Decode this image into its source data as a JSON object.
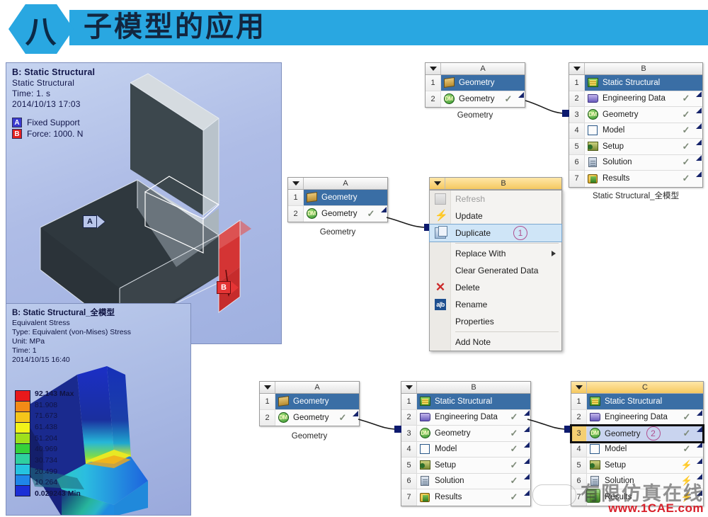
{
  "title": {
    "badge": "八",
    "heading": "子模型的应用"
  },
  "viewport_top": {
    "line1": "B: Static Structural",
    "line2": "Static Structural",
    "line3": "Time: 1. s",
    "line4": "2014/10/13 17:03",
    "tag_a_chip": "A",
    "tag_a_label": "Fixed Support",
    "tag_b_chip": "B",
    "tag_b_label": "Force: 1000. N",
    "marker_a": "A",
    "marker_b": "B"
  },
  "viewport_bottom": {
    "line1": "B: Static Structural_全模型",
    "line2": "Equivalent Stress",
    "line3": "Type: Equivalent (von-Mises) Stress",
    "line4": "Unit: MPa",
    "line5": "Time: 1",
    "line6": "2014/10/15 16:40",
    "legend_values": [
      "92.143 Max",
      "81.908",
      "71.673",
      "61.438",
      "51.204",
      "40.969",
      "30.734",
      "20.499",
      "10.264",
      "0.029243 Min"
    ],
    "legend_colors": [
      "#e8191b",
      "#f28a16",
      "#f5c51a",
      "#f2f319",
      "#9fe01c",
      "#36d13a",
      "#2fd0a0",
      "#25c3e0",
      "#1f86e8",
      "#1c2fd6"
    ]
  },
  "systems": {
    "geom_top": {
      "column": "A",
      "caption": "Geometry",
      "rows": [
        {
          "n": "1",
          "icon": "geometry-box-icon",
          "label": "Geometry",
          "state": "",
          "selected": true
        },
        {
          "n": "2",
          "icon": "design-modeler-icon",
          "label": "Geometry",
          "state": "✓",
          "selected": false
        }
      ]
    },
    "static_top": {
      "column": "B",
      "caption": "Static Structural_全模型",
      "rows": [
        {
          "n": "1",
          "icon": "static-structural-icon",
          "label": "Static Structural",
          "state": "",
          "selected": true
        },
        {
          "n": "2",
          "icon": "engineering-data-icon",
          "label": "Engineering Data",
          "state": "✓",
          "selected": false
        },
        {
          "n": "3",
          "icon": "design-modeler-icon",
          "label": "Geometry",
          "state": "✓",
          "selected": false
        },
        {
          "n": "4",
          "icon": "model-icon",
          "label": "Model",
          "state": "✓",
          "selected": false
        },
        {
          "n": "5",
          "icon": "setup-icon",
          "label": "Setup",
          "state": "✓",
          "selected": false
        },
        {
          "n": "6",
          "icon": "solution-icon",
          "label": "Solution",
          "state": "✓",
          "selected": false
        },
        {
          "n": "7",
          "icon": "results-icon",
          "label": "Results",
          "state": "✓",
          "selected": false
        }
      ]
    },
    "geom_mid": {
      "column": "A",
      "caption": "Geometry",
      "rows": [
        {
          "n": "1",
          "icon": "geometry-box-icon",
          "label": "Geometry",
          "state": "",
          "selected": true
        },
        {
          "n": "2",
          "icon": "design-modeler-icon",
          "label": "Geometry",
          "state": "✓",
          "selected": false
        }
      ]
    },
    "static_mid": {
      "column": "B"
    },
    "geom_bottom": {
      "column": "A",
      "caption": "Geometry",
      "rows": [
        {
          "n": "1",
          "icon": "geometry-box-icon",
          "label": "Geometry",
          "state": "",
          "selected": true
        },
        {
          "n": "2",
          "icon": "design-modeler-icon",
          "label": "Geometry",
          "state": "✓",
          "selected": false
        }
      ]
    },
    "static_bottom": {
      "column": "B",
      "rows": [
        {
          "n": "1",
          "icon": "static-structural-icon",
          "label": "Static Structural",
          "state": "",
          "selected": true
        },
        {
          "n": "2",
          "icon": "engineering-data-icon",
          "label": "Engineering Data",
          "state": "✓",
          "selected": false
        },
        {
          "n": "3",
          "icon": "design-modeler-icon",
          "label": "Geometry",
          "state": "✓",
          "selected": false
        },
        {
          "n": "4",
          "icon": "model-icon",
          "label": "Model",
          "state": "✓",
          "selected": false
        },
        {
          "n": "5",
          "icon": "setup-icon",
          "label": "Setup",
          "state": "✓",
          "selected": false
        },
        {
          "n": "6",
          "icon": "solution-icon",
          "label": "Solution",
          "state": "✓",
          "selected": false
        },
        {
          "n": "7",
          "icon": "results-icon",
          "label": "Results",
          "state": "✓",
          "selected": false
        }
      ]
    },
    "copy_c": {
      "column": "C",
      "step_badge": "2",
      "rows": [
        {
          "n": "1",
          "icon": "static-structural-icon",
          "label": "Static Structural",
          "state": "",
          "selected": true
        },
        {
          "n": "2",
          "icon": "engineering-data-icon",
          "label": "Engineering Data",
          "state": "✓",
          "selected": false
        },
        {
          "n": "3",
          "icon": "design-modeler-icon",
          "label": "Geometry",
          "state": "✓",
          "selected": false
        },
        {
          "n": "4",
          "icon": "model-icon",
          "label": "Model",
          "state": "✓",
          "selected": false
        },
        {
          "n": "5",
          "icon": "setup-icon",
          "label": "Setup",
          "state": "⚡",
          "selected": false
        },
        {
          "n": "6",
          "icon": "solution-icon",
          "label": "Solution",
          "state": "⚡",
          "selected": false
        },
        {
          "n": "7",
          "icon": "results-icon",
          "label": "Results",
          "state": "⚡",
          "selected": false
        }
      ]
    }
  },
  "context_menu": {
    "step_badge": "1",
    "items": [
      {
        "label": "Refresh",
        "icon": "refresh-icon",
        "disabled": true,
        "highlighted": false,
        "submenu": false
      },
      {
        "label": "Update",
        "icon": "update-icon",
        "disabled": false,
        "highlighted": false,
        "submenu": false
      },
      {
        "label": "Duplicate",
        "icon": "duplicate-icon",
        "disabled": false,
        "highlighted": true,
        "submenu": false
      },
      {
        "label": "Replace With",
        "icon": "",
        "disabled": false,
        "highlighted": false,
        "submenu": true
      },
      {
        "label": "Clear Generated Data",
        "icon": "",
        "disabled": false,
        "highlighted": false,
        "submenu": false
      },
      {
        "label": "Delete",
        "icon": "delete-icon",
        "disabled": false,
        "highlighted": false,
        "submenu": false
      },
      {
        "label": "Rename",
        "icon": "rename-icon",
        "disabled": false,
        "highlighted": false,
        "submenu": false
      },
      {
        "label": "Properties",
        "icon": "",
        "disabled": false,
        "highlighted": false,
        "submenu": false
      },
      {
        "label": "Add Note",
        "icon": "",
        "disabled": false,
        "highlighted": false,
        "submenu": false
      }
    ]
  },
  "watermarks": {
    "center": "1CAE.COM",
    "bottom_cn": "有限仿真在线",
    "bottom_url": "www.1CAE.com"
  }
}
